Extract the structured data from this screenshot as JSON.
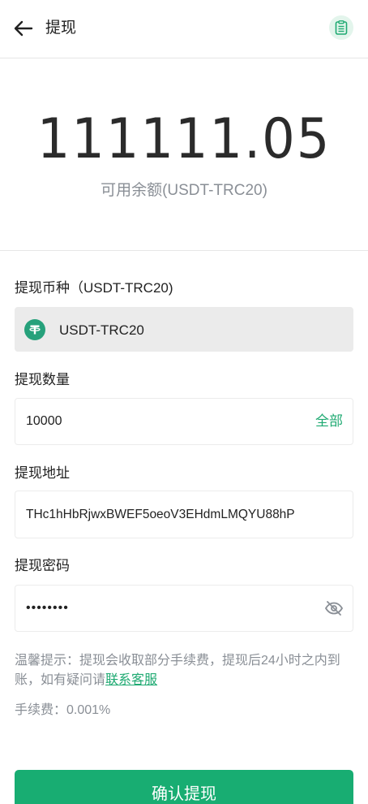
{
  "header": {
    "title": "提现",
    "back_icon": "arrow-left-icon",
    "record_icon": "clipboard-icon"
  },
  "balance": {
    "amount": "111111.05",
    "label": "可用余额(USDT-TRC20)"
  },
  "form": {
    "coin": {
      "label": "提现币种（USDT-TRC20)",
      "value": "USDT-TRC20",
      "icon": "tether-icon"
    },
    "amount": {
      "label": "提现数量",
      "value": "10000",
      "all_label": "全部"
    },
    "address": {
      "label": "提现地址",
      "value": "THc1hHbRjwxBWEF5oeoV3EHdmLMQYU88hP"
    },
    "password": {
      "label": "提现密码",
      "value": "12345678",
      "eye_icon": "eye-off-icon"
    }
  },
  "tip": {
    "text": "温馨提示：提现会收取部分手续费，提现后24小时之内到账，如有疑问请",
    "link": "联系客服"
  },
  "fee": {
    "text": "手续费：0.001%"
  },
  "submit": {
    "label": "确认提现"
  },
  "colors": {
    "accent": "#18ad72",
    "tether": "#26a17b"
  }
}
